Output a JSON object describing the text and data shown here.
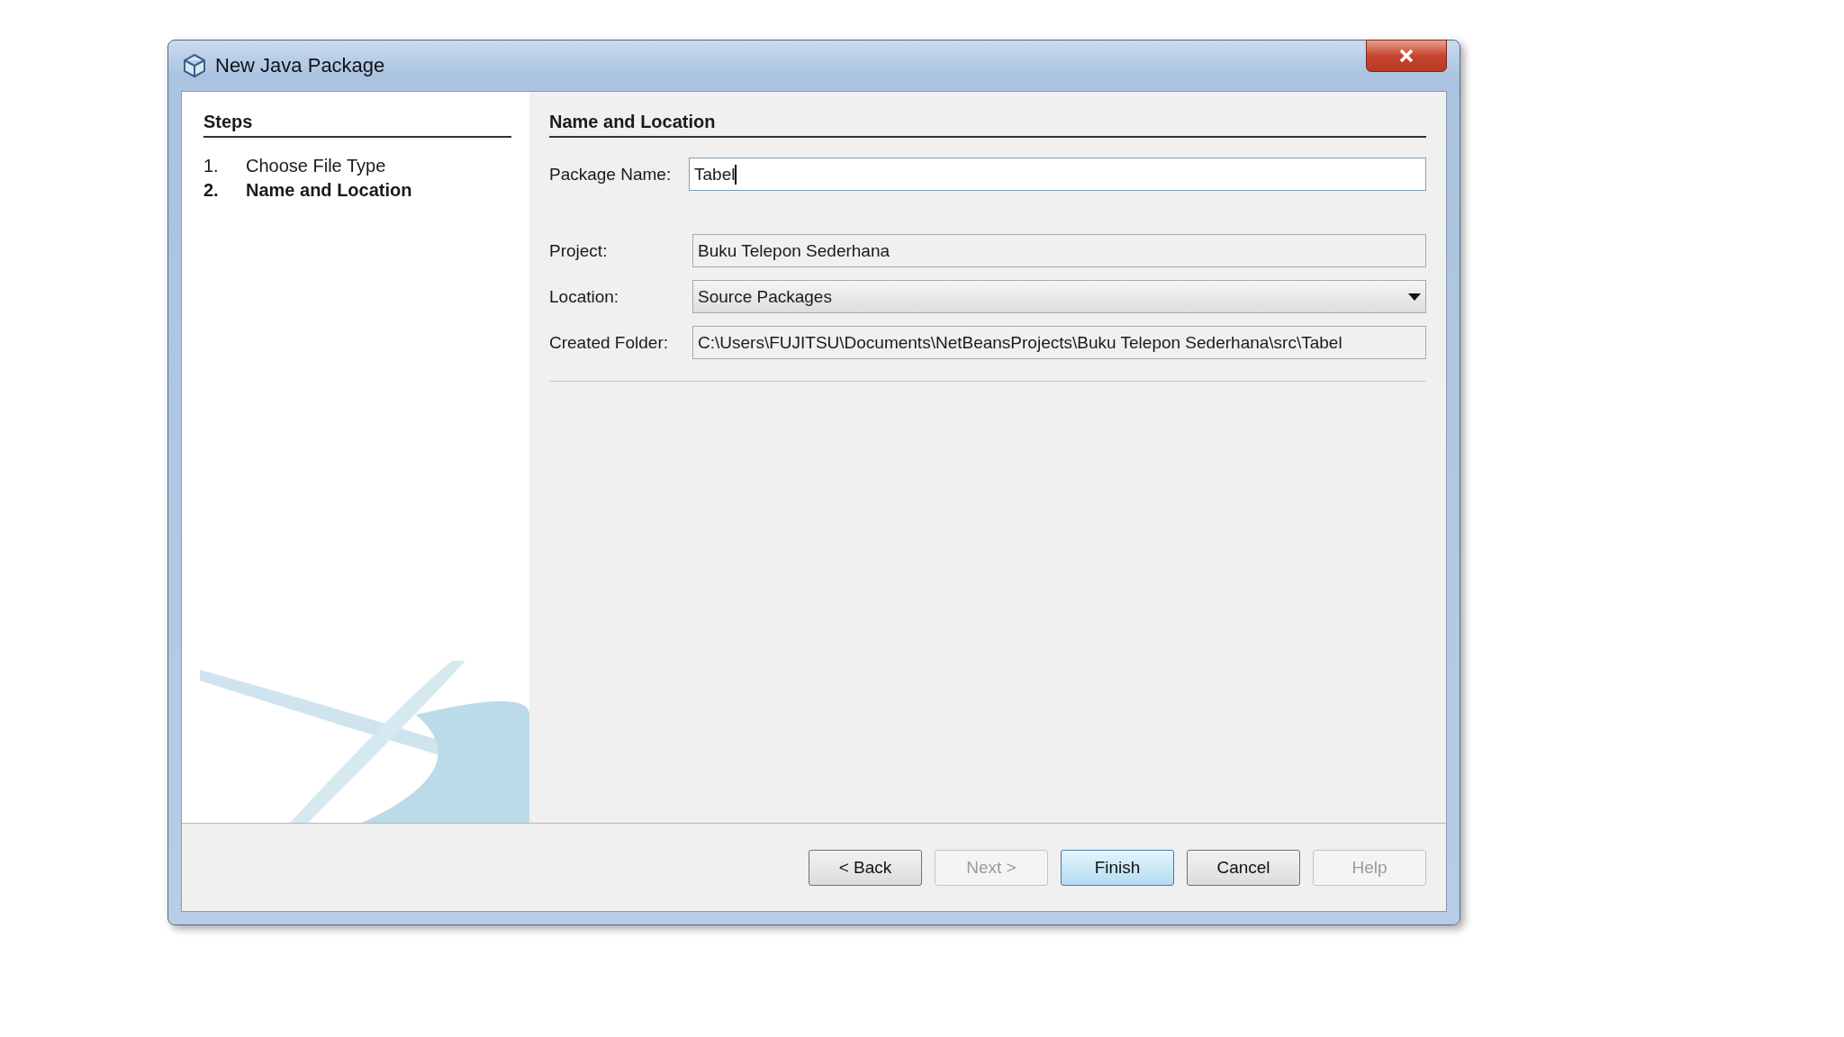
{
  "window": {
    "title": "New Java Package"
  },
  "steps": {
    "title": "Steps",
    "items": [
      {
        "number": "1.",
        "label": "Choose File Type",
        "selected": false
      },
      {
        "number": "2.",
        "label": "Name and Location",
        "selected": true
      }
    ]
  },
  "panel": {
    "title": "Name and Location",
    "fields": [
      {
        "kind": "text",
        "label": "Package Name:",
        "value": "Tabel",
        "editable": true,
        "focused": true
      },
      {
        "kind": "text",
        "label": "Project:",
        "value": "Buku Telepon Sederhana",
        "editable": false,
        "focused": false
      },
      {
        "kind": "dropdown",
        "label": "Location:",
        "value": "Source Packages"
      },
      {
        "kind": "text",
        "label": "Created Folder:",
        "value": "C:\\Users\\FUJITSU\\Documents\\NetBeansProjects\\Buku Telepon Sederhana\\src\\Tabel",
        "editable": false,
        "focused": false
      }
    ]
  },
  "buttons": [
    {
      "label": "< Back",
      "disabled": false,
      "default": false
    },
    {
      "label": "Next >",
      "disabled": true,
      "default": false
    },
    {
      "label": "Finish",
      "disabled": false,
      "default": true
    },
    {
      "label": "Cancel",
      "disabled": false,
      "default": false
    },
    {
      "label": "Help",
      "disabled": true,
      "default": false
    }
  ]
}
